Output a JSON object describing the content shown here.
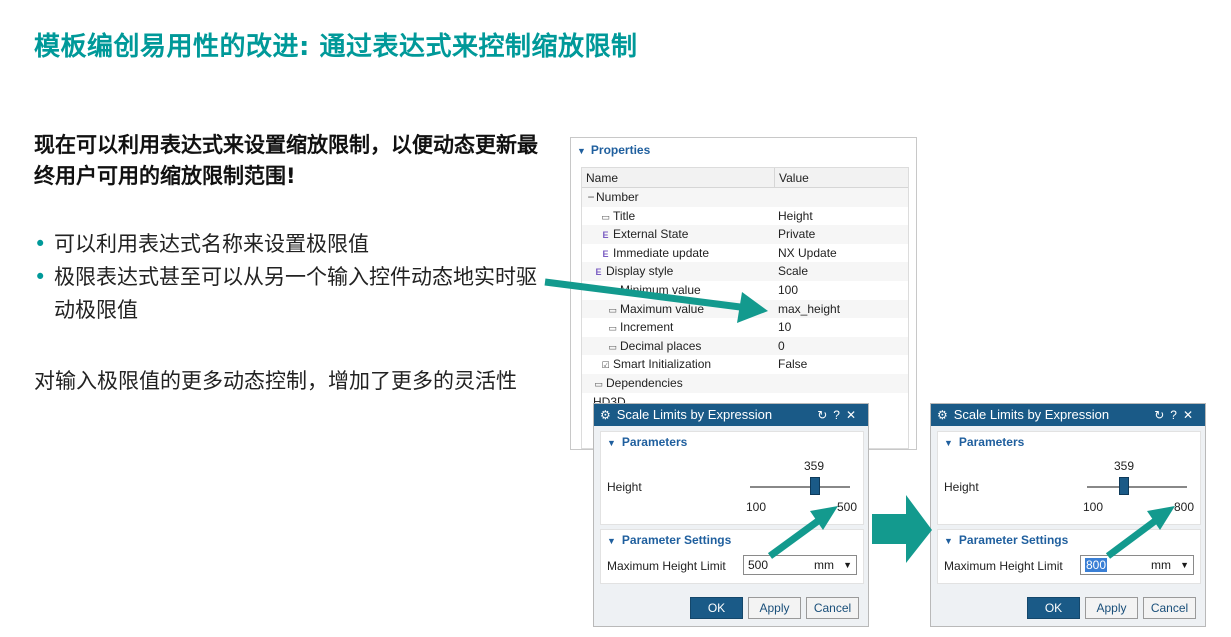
{
  "slide": {
    "title": "模板编创易用性的改进: 通过表达式来控制缩放限制",
    "intro": "现在可以利用表达式来设置缩放限制，以便动态更新最终用户可用的缩放限制范围!",
    "bullets": [
      "可以利用表达式名称来设置极限值",
      "极限表达式甚至可以从另一个输入控件动态地实时驱动极限值"
    ],
    "closing": "对输入极限值的更多动态控制，增加了更多的灵活性",
    "accent_color": "#009999"
  },
  "properties": {
    "header": "Properties",
    "col_name": "Name",
    "col_value": "Value",
    "rows": [
      {
        "name": "Number",
        "value": "",
        "icon": "minus-expander",
        "indent": 0
      },
      {
        "name": "Title",
        "value": "Height",
        "icon": "field-icon",
        "indent": 2
      },
      {
        "name": "External State",
        "value": "Private",
        "icon": "e-icon",
        "indent": 2
      },
      {
        "name": "Immediate update",
        "value": "NX Update",
        "icon": "e-icon",
        "indent": 2
      },
      {
        "name": "Display style",
        "value": "Scale",
        "icon": "e-icon",
        "indent": 1
      },
      {
        "name": "Minimum value",
        "value": "100",
        "icon": "field-icon",
        "indent": 3
      },
      {
        "name": "Maximum value",
        "value": "max_height",
        "icon": "field-icon",
        "indent": 3
      },
      {
        "name": "Increment",
        "value": "10",
        "icon": "field-icon",
        "indent": 3
      },
      {
        "name": "Decimal places",
        "value": "0",
        "icon": "field-icon",
        "indent": 3
      },
      {
        "name": "Smart Initialization",
        "value": "False",
        "icon": "check-icon",
        "indent": 2
      },
      {
        "name": "Dependencies",
        "value": "",
        "icon": "field-icon",
        "indent": 1
      },
      {
        "name": "HD3D",
        "value": "",
        "icon": "",
        "indent": 1
      }
    ]
  },
  "dialogs": [
    {
      "title": "Scale Limits by Expression",
      "parameters_label": "Parameters",
      "height_label": "Height",
      "current_value": "359",
      "min_label": "100",
      "max_label": "500",
      "level_fraction": 0.647,
      "settings_label": "Parameter Settings",
      "limit_label": "Maximum Height Limit",
      "limit_value": "500",
      "unit": "mm",
      "ok": "OK",
      "apply": "Apply",
      "cancel": "Cancel"
    },
    {
      "title": "Scale Limits by Expression",
      "parameters_label": "Parameters",
      "height_label": "Height",
      "current_value": "359",
      "min_label": "100",
      "max_label": "800",
      "level_fraction": 0.37,
      "settings_label": "Parameter Settings",
      "limit_label": "Maximum Height Limit",
      "limit_value": "800",
      "unit": "mm",
      "ok": "OK",
      "apply": "Apply",
      "cancel": "Cancel"
    }
  ]
}
